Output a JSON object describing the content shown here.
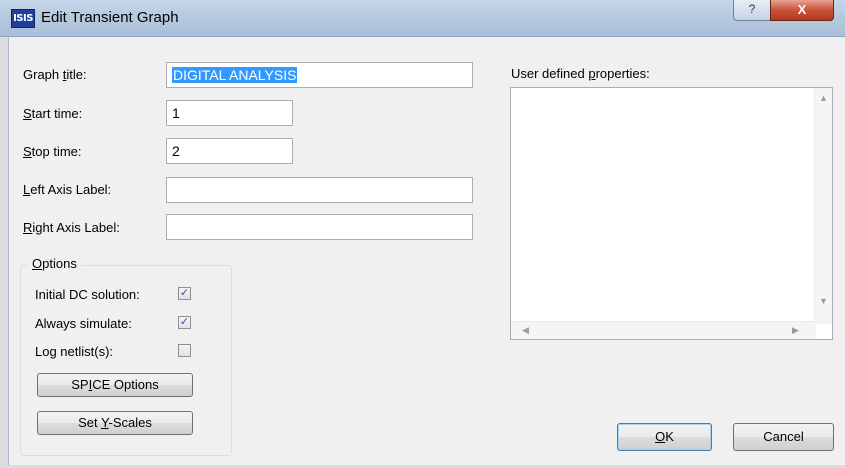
{
  "window": {
    "app_icon": "ISIS",
    "title": "Edit Transient Graph",
    "help_button": "?",
    "close_button": "X"
  },
  "form": {
    "graph_title": {
      "label_pre": "Graph ",
      "label_key": "t",
      "label_post": "itle:",
      "value": "DIGITAL ANALYSIS"
    },
    "start_time": {
      "label_pre": "",
      "label_key": "S",
      "label_post": "tart time:",
      "value": "1"
    },
    "stop_time": {
      "label_pre": "",
      "label_key": "S",
      "label_post": "top time:",
      "value": "2"
    },
    "left_axis": {
      "label_pre": "",
      "label_key": "L",
      "label_post": "eft Axis Label:",
      "value": ""
    },
    "right_axis": {
      "label_pre": "",
      "label_key": "R",
      "label_post": "ight Axis Label:",
      "value": ""
    }
  },
  "options": {
    "legend_key": "O",
    "legend_post": "ptions",
    "initial_dc": {
      "label": "Initial DC solution:",
      "checked": true
    },
    "always_simulate": {
      "label": "Always simulate:",
      "checked": true
    },
    "log_netlist": {
      "label": "Log netlist(s):",
      "checked": false
    },
    "spice_pre": "SP",
    "spice_key": "I",
    "spice_post": "CE Options",
    "yscales_pre": "Set ",
    "yscales_key": "Y",
    "yscales_post": "-Scales"
  },
  "user_props": {
    "label_pre": "User defined ",
    "label_key": "p",
    "label_post": "roperties:",
    "content": ""
  },
  "buttons": {
    "ok_key": "O",
    "ok_post": "K",
    "cancel": "Cancel"
  },
  "icons": {
    "check": "✓",
    "scroll_up": "▲",
    "scroll_down": "▼",
    "scroll_left": "◀",
    "scroll_right": "▶"
  }
}
